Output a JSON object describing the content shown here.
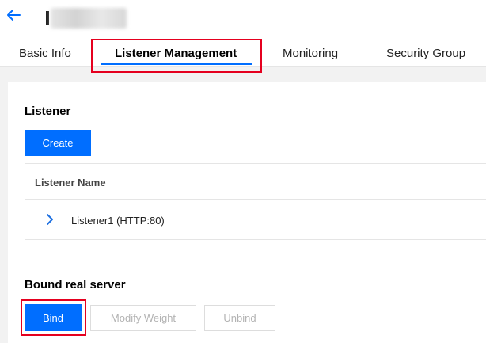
{
  "header": {
    "title_initial": "I"
  },
  "tabs": [
    {
      "label": "Basic Info",
      "active": false
    },
    {
      "label": "Listener Management",
      "active": true
    },
    {
      "label": "Monitoring",
      "active": false
    },
    {
      "label": "Security Group",
      "active": false
    }
  ],
  "listener_section": {
    "title": "Listener",
    "create_label": "Create",
    "table": {
      "columns": [
        "Listener Name"
      ],
      "rows": [
        {
          "name": "Listener1 (HTTP:80)"
        }
      ]
    }
  },
  "bound_section": {
    "title": "Bound real server",
    "bind_label": "Bind",
    "modify_weight_label": "Modify Weight",
    "unbind_label": "Unbind"
  },
  "colors": {
    "accent": "#006eff",
    "highlight": "#e5001f",
    "disabled_text": "#b3b3b3"
  },
  "icons": {
    "back": "arrow-left-icon",
    "expander": "chevron-right-icon"
  }
}
